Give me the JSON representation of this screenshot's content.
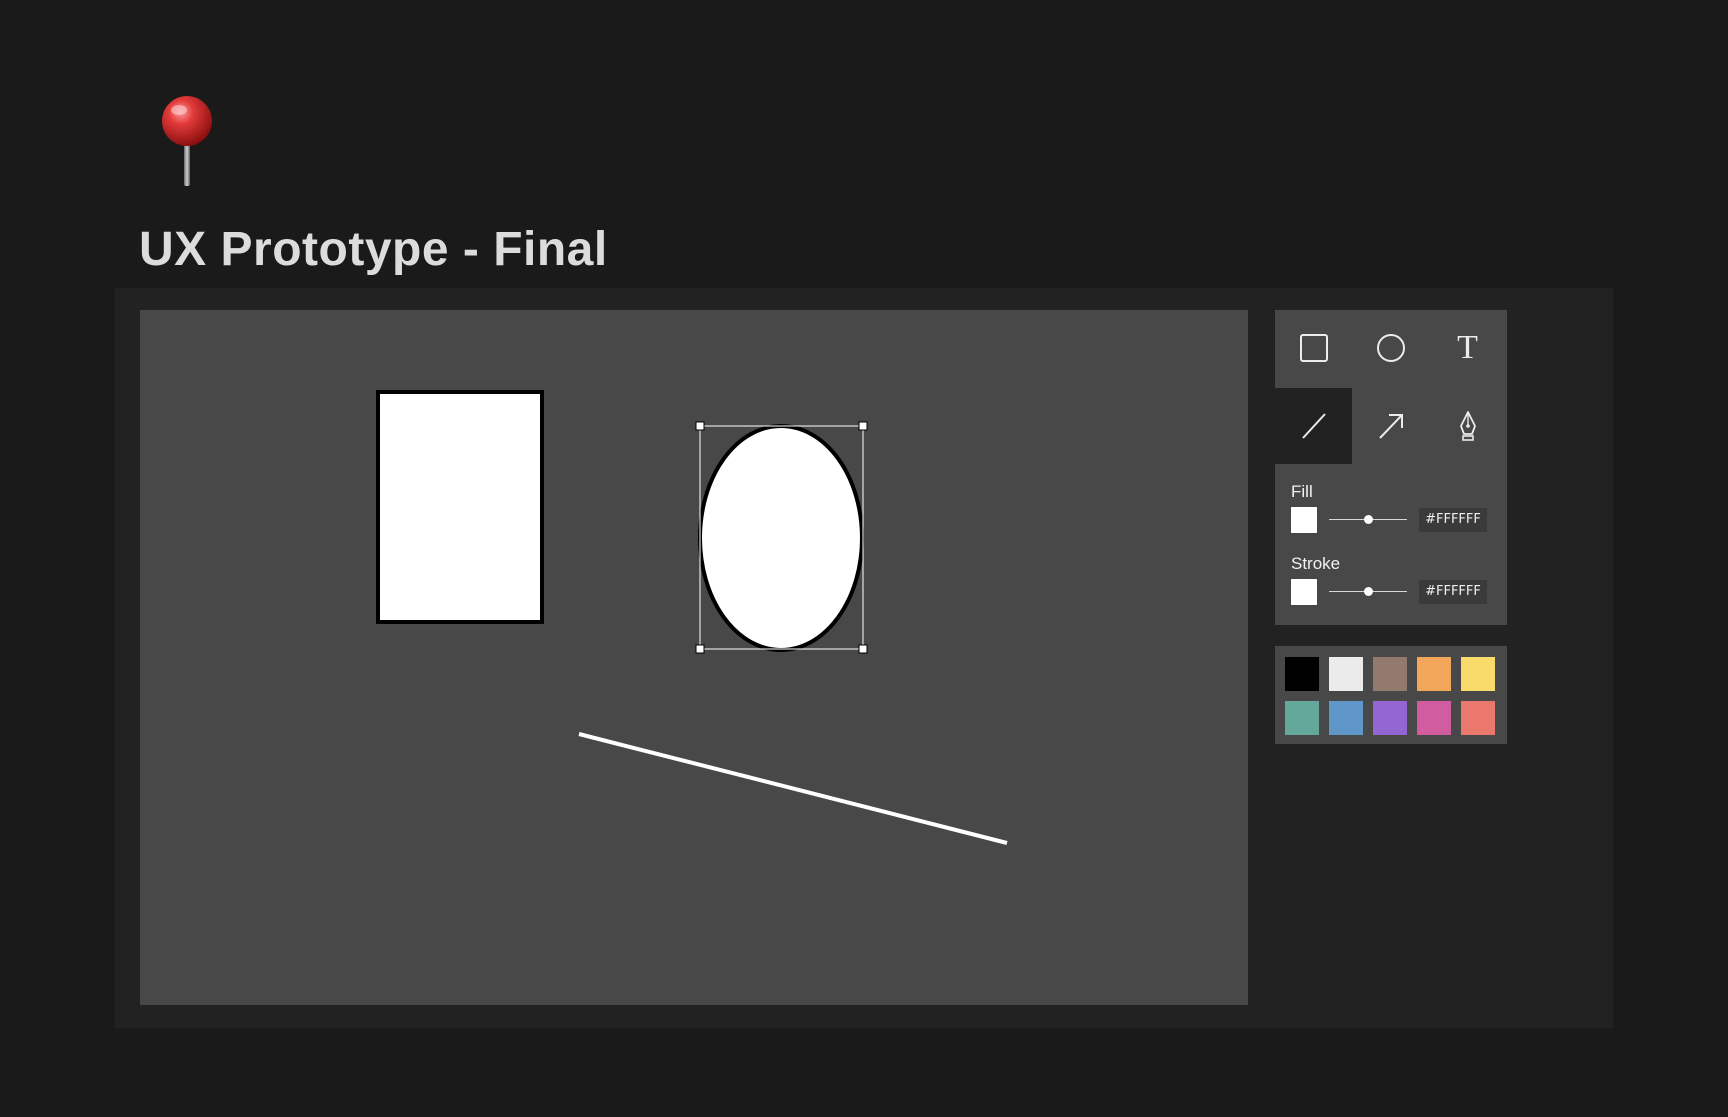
{
  "page": {
    "title": "UX Prototype - Final"
  },
  "toolbar": {
    "tools": [
      {
        "name": "rectangle",
        "icon": "square-icon"
      },
      {
        "name": "ellipse",
        "icon": "circle-icon"
      },
      {
        "name": "text",
        "icon": "text-icon",
        "glyph": "T"
      },
      {
        "name": "line",
        "icon": "line-icon",
        "active": true
      },
      {
        "name": "arrow",
        "icon": "arrow-icon"
      },
      {
        "name": "pen",
        "icon": "pen-icon"
      }
    ]
  },
  "properties": {
    "fill": {
      "label": "Fill",
      "color": "#FFFFFF",
      "hex": "#FFFFFF",
      "level": 0.5
    },
    "stroke": {
      "label": "Stroke",
      "color": "#FFFFFF",
      "hex": "#FFFFFF",
      "level": 0.5
    }
  },
  "palette": {
    "colors": [
      "#000000",
      "#EBEBEB",
      "#937A6F",
      "#F2A65A",
      "#F8DB6B",
      "#63A89A",
      "#5F97C9",
      "#9466D1",
      "#D15C9F",
      "#EB786C"
    ]
  },
  "colors": {
    "background": "#1A1A1A",
    "frame": "#222222",
    "canvas": "#484848",
    "title": "#DCDCDC"
  }
}
